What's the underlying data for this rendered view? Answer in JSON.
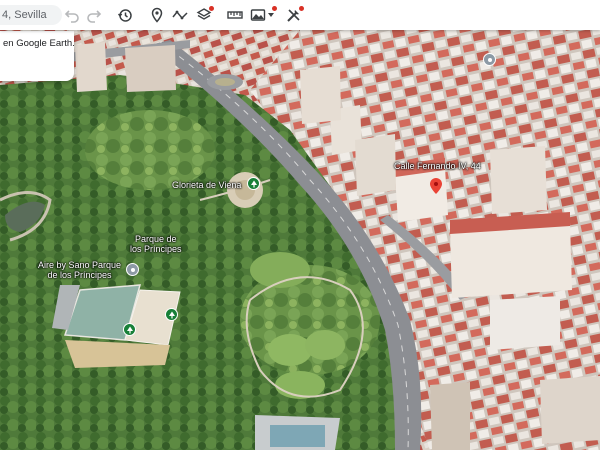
{
  "search": {
    "value": "4, Sevilla"
  },
  "info_panel": {
    "text": "en Google Earth."
  },
  "toolbar": {
    "icons": [
      "undo-icon",
      "redo-icon",
      "history-icon",
      "placemark-icon",
      "path-icon",
      "layers-icon",
      "ruler-icon",
      "map-style-icon",
      "tools-icon"
    ],
    "badge_color": "#d93025"
  },
  "labels": {
    "address": "Calle Fernando IV, 44",
    "glorieta": "Glorieta de Viena",
    "parque_line1": "Parque de",
    "parque_line2": "los Príncipes",
    "aire_line1": "Aire by Sano Parque",
    "aire_line2": "de los Príncipes"
  },
  "colors": {
    "pin_green": "#188038",
    "pin_red": "#ea4335",
    "pin_gray": "#8d9aa5"
  }
}
